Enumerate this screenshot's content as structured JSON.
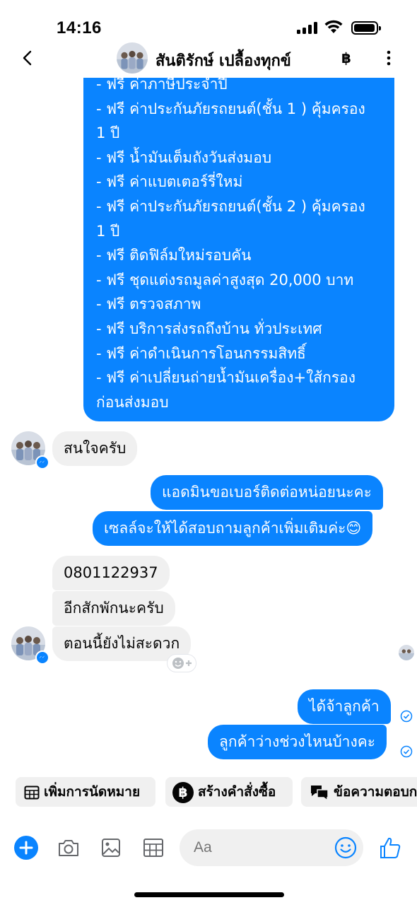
{
  "status_bar": {
    "time": "14:16"
  },
  "header": {
    "contact_name": "สันติรักษ์ เปลื้องทุกข์",
    "baht_symbol": "฿"
  },
  "messages": {
    "promo_lines": [
      " - ฟรี ค่าภาษีประจำปี",
      " - ฟรี ค่าประกันภัยรถยนต์(ชั้น 1 ) คุ้มครอง",
      "1 ปี",
      " - ฟรี น้ำมันเต็มถังวันส่งมอบ",
      " - ฟรี ค่าแบตเตอร์รี่ใหม่",
      " - ฟรี ค่าประกันภัยรถยนต์(ชั้น 2 ) คุ้มครอง",
      "1 ปี",
      " - ฟรี ติดฟิล์มใหม่รอบคัน",
      " - ฟรี ชุดแต่งรถมูลค่าสูงสุด 20,000 บาท",
      " - ฟรี ตรวจสภาพ",
      " - ฟรี บริการส่งรถถึงบ้าน ทั่วประเทศ",
      " - ฟรี ค่าดำเนินการโอนกรรมสิทธิ์",
      " - ฟรี ค่าเปลี่ยนถ่ายน้ำมันเครื่อง+ใส้กรอง",
      "ก่อนส่งมอบ"
    ],
    "in_interested": "สนใจครับ",
    "out_ask_phone": "แอดมินขอเบอร์ติดต่อหน่อยนะคะ",
    "out_sales_will": "เซลล์จะให้ได้สอบถามลูกค้าเพิ่มเติมค่ะ😊",
    "in_phone": "0801122937",
    "in_wait": "อีกสักพักนะครับ",
    "in_busy": "ตอนนี้ยังไม่สะดวก",
    "out_ok": "ได้จ้าลูกค้า",
    "out_when": "ลูกค้าว่างช่วงไหนบ้างคะ"
  },
  "quick_actions": {
    "appointment": "เพิ่มการนัดหมาย",
    "create_order": "สร้างคำสั่งซื้อ",
    "saved_replies": "ข้อความตอบก"
  },
  "composer": {
    "placeholder": "Aa"
  },
  "colors": {
    "accent": "#0a84ff",
    "incoming_bubble": "#f0f0f0"
  }
}
